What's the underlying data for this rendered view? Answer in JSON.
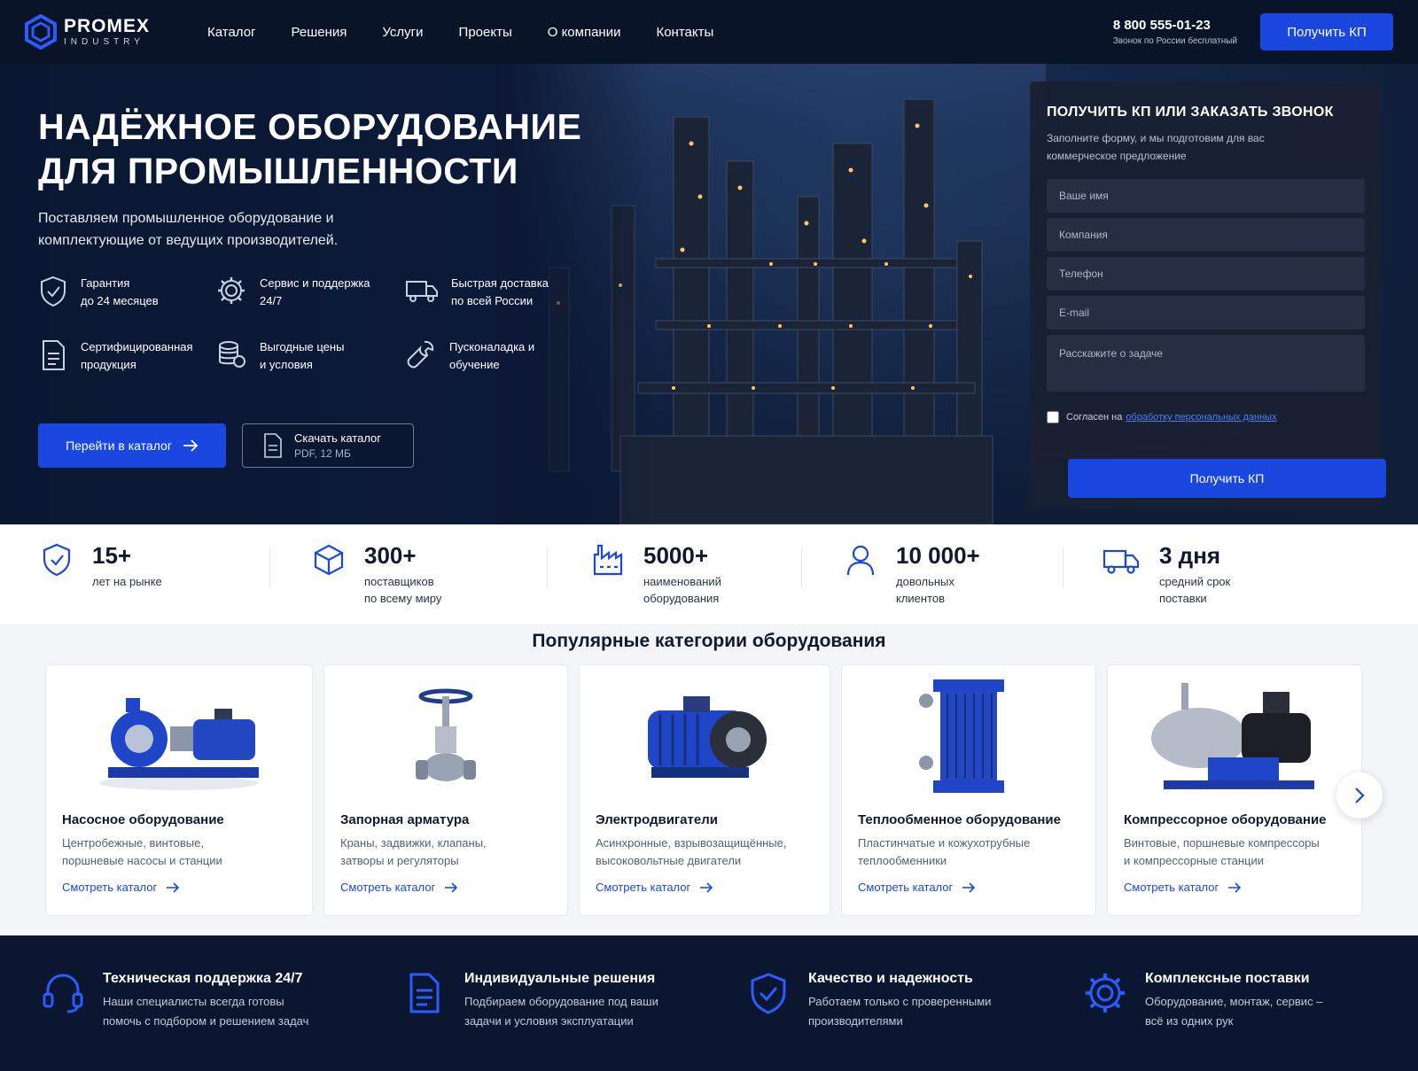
{
  "header": {
    "logo_main": "PROMEX",
    "logo_sub": "INDUSTRY",
    "nav": [
      "Каталог",
      "Решения",
      "Услуги",
      "Проекты",
      "О компании",
      "Контакты"
    ],
    "phone": "8 800 555-01-23",
    "phone_note": "Звонок по России бесплатный",
    "cta": "Получить КП"
  },
  "hero": {
    "title_line1": "НАДЁЖНОЕ ОБОРУДОВАНИЕ",
    "title_line2": "ДЛЯ ПРОМЫШЛЕННОСТИ",
    "subtitle": "Поставляем промышленное оборудование и комплектующие от ведущих производителей.",
    "features": [
      {
        "icon": "shield-check-icon",
        "text": "Гарантия\nдо 24 месяцев"
      },
      {
        "icon": "gear-icon",
        "text": "Сервис и поддержка\n24/7"
      },
      {
        "icon": "truck-icon",
        "text": "Быстрая доставка\nпо всей России"
      },
      {
        "icon": "document-icon",
        "text": "Сертифицированная\nпродукция"
      },
      {
        "icon": "coins-icon",
        "text": "Выгодные цены\nи условия"
      },
      {
        "icon": "wrench-icon",
        "text": "Пусконаладка и\nобучение"
      }
    ],
    "catalog_button": "Перейти в каталог",
    "download_title": "Скачать каталог",
    "download_meta": "PDF, 12 МБ"
  },
  "form": {
    "title": "ПОЛУЧИТЬ КП ИЛИ ЗАКАЗАТЬ ЗВОНОК",
    "description": "Заполните форму, и мы подготовим для вас коммерческое предложение",
    "name_placeholder": "Ваше имя",
    "company_placeholder": "Компания",
    "phone_placeholder": "Телефон",
    "email_placeholder": "E-mail",
    "task_placeholder": "Расскажите о задаче",
    "consent_text": "Согласен на",
    "consent_link": "обработку персональных данных",
    "submit": "Получить КП"
  },
  "stats": [
    {
      "icon": "shield-check-icon",
      "value": "15+",
      "label": "лет на рынке"
    },
    {
      "icon": "cube-icon",
      "value": "300+",
      "label": "поставщиков\nпо всему миру"
    },
    {
      "icon": "factory-icon",
      "value": "5000+",
      "label": "наименований\nоборудования"
    },
    {
      "icon": "user-icon",
      "value": "10 000+",
      "label": "довольных\nклиентов"
    },
    {
      "icon": "truck-icon",
      "value": "3 дня",
      "label": "средний срок\nпоставки"
    }
  ],
  "categories": {
    "title": "Популярные категории оборудования",
    "link_label": "Смотреть каталог",
    "items": [
      {
        "name": "Насосное оборудование",
        "desc": "Центробежные, винтовые,\nпоршневые насосы и станции"
      },
      {
        "name": "Запорная арматура",
        "desc": "Краны, задвижки, клапаны,\nзатворы и регуляторы"
      },
      {
        "name": "Электродвигатели",
        "desc": "Асинхронные, взрывозащищённые,\nвысоковольтные двигатели"
      },
      {
        "name": "Теплообменное оборудование",
        "desc": "Пластинчатые и кожухотрубные\nтеплообменники"
      },
      {
        "name": "Компрессорное оборудование",
        "desc": "Винтовые, поршневые компрессоры\nи компрессорные станции"
      }
    ]
  },
  "advantages": [
    {
      "icon": "headset-icon",
      "title": "Техническая поддержка 24/7",
      "text": "Наши специалисты всегда готовы\nпомочь с подбором и решением задач"
    },
    {
      "icon": "document-icon",
      "title": "Индивидуальные решения",
      "text": "Подбираем оборудование под ваши\nзадачи и условия эксплуатации"
    },
    {
      "icon": "shield-check-icon",
      "title": "Качество и надежность",
      "text": "Работаем только с проверенными\nпроизводителями"
    },
    {
      "icon": "gear-icon",
      "title": "Комплексные поставки",
      "text": "Оборудование, монтаж, сервис –\nвсё из одних рук"
    }
  ],
  "colors": {
    "accent": "#1a47e0",
    "header_bg": "#0a1428",
    "footer_bg": "#0b1631",
    "form_bg": "#182032"
  }
}
